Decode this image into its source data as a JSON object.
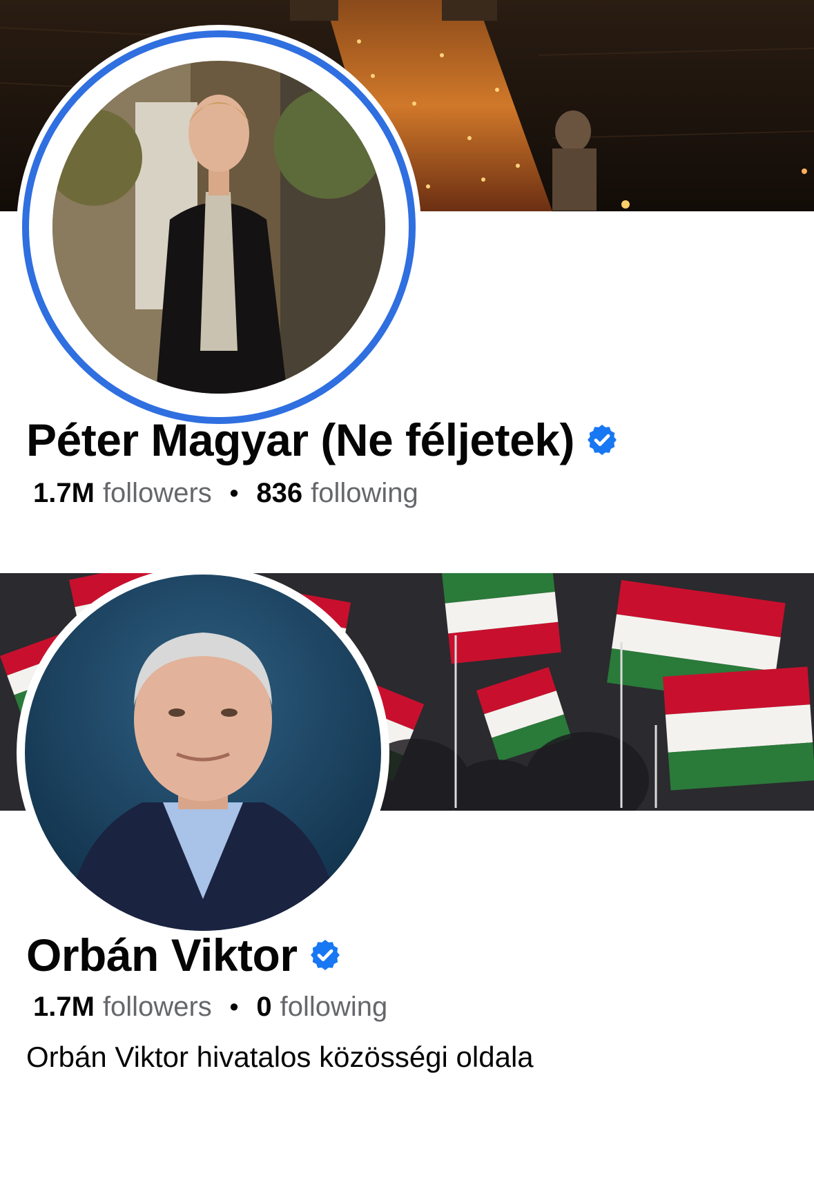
{
  "colors": {
    "verified_blue": "#1877f2",
    "story_ring": "#2f6fe0",
    "secondary_text": "#65676b",
    "flag_red": "#c8102e",
    "flag_green": "#2a7a3a"
  },
  "profiles": [
    {
      "name": "Péter Magyar (Ne féljetek)",
      "verified_icon": "verified-badge-icon",
      "followers_count": "1.7M",
      "followers_label": "followers",
      "separator": "•",
      "following_count": "836",
      "following_label": "following",
      "has_story_ring": true
    },
    {
      "name": "Orbán Viktor",
      "verified_icon": "verified-badge-icon",
      "followers_count": "1.7M",
      "followers_label": "followers",
      "separator": "•",
      "following_count": "0",
      "following_label": "following",
      "bio": "Orbán Viktor hivatalos közösségi oldala",
      "has_story_ring": false
    }
  ]
}
